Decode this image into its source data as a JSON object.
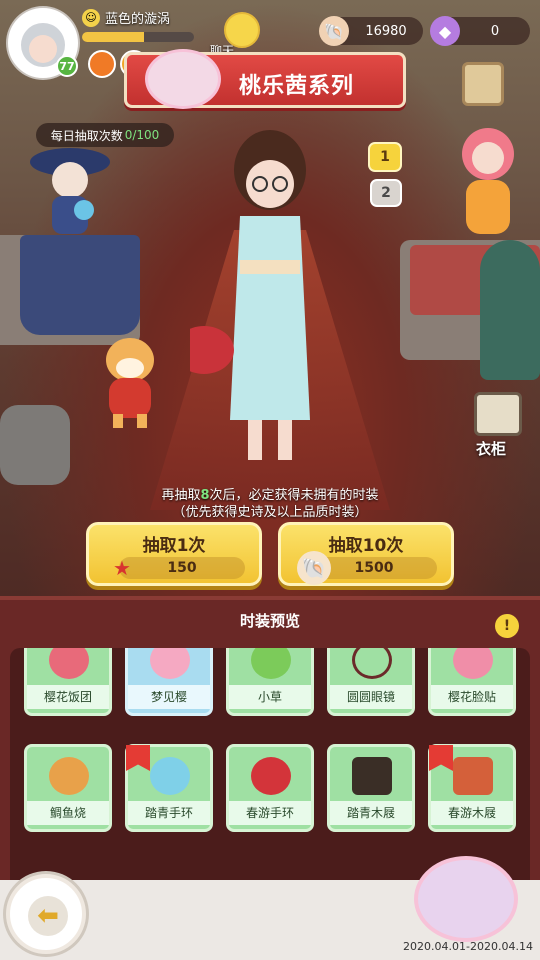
{
  "player": {
    "name": "蓝色的漩涡",
    "level": "77",
    "xp_fraction": 0.55
  },
  "chat": {
    "label": "聊天"
  },
  "currencies": {
    "shell": "16980",
    "gem": "0"
  },
  "banner": {
    "title": "桃乐茜系列"
  },
  "daily_draws": {
    "label": "每日抽取次数",
    "count": "0/100"
  },
  "pages": [
    "1",
    "2"
  ],
  "wardrobe": {
    "label": "衣柜"
  },
  "hint": {
    "line1_prefix": "再抽取",
    "line1_number": "8",
    "line1_suffix": "次后，必定获得未拥有的时装",
    "line2": "（优先获得史诗及以上品质时装）"
  },
  "draw_buttons": [
    {
      "label": "抽取1次",
      "cost": "150",
      "currency_icon": "starfish-icon"
    },
    {
      "label": "抽取10次",
      "cost": "1500",
      "currency_icon": "shell-icon"
    }
  ],
  "preview": {
    "title": "时装预览",
    "row1": [
      "樱花饭团",
      "梦见樱",
      "小草",
      "圆圆眼镜",
      "樱花脸贴"
    ],
    "row2": [
      "鲷鱼烧",
      "踏青手环",
      "春游手环",
      "踏青木屐",
      "春游木屐"
    ]
  },
  "event": {
    "date_range": "2020.04.01-2020.04.14"
  },
  "colors": {
    "banner_red": "#d43b38",
    "button_yellow": "#f6d33c",
    "card_green": "#9fe0a3",
    "card_blue": "#a9dcf0",
    "highlight_green": "#7fe27f"
  }
}
